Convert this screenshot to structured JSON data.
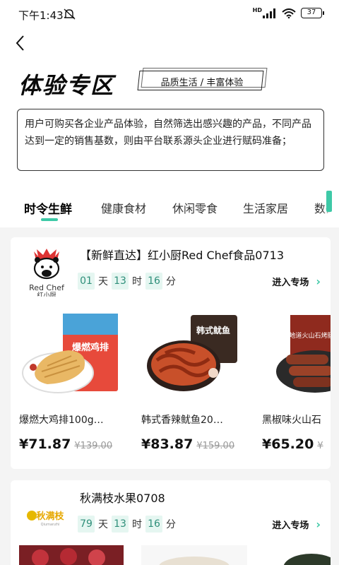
{
  "status_bar": {
    "time": "下午1:43",
    "network": "HD",
    "battery": "37"
  },
  "page": {
    "title": "体验专区",
    "tagline": "品质生活 / 丰富体验",
    "intro": "用户可购买各企业产品体验，自然筛选出感兴趣的产品，不同产品达到一定的销售基数，则由平台联系源头企业进行赋码准备；"
  },
  "tabs": [
    {
      "label": "时令生鲜",
      "active": true
    },
    {
      "label": "健康食材",
      "active": false
    },
    {
      "label": "休闲零食",
      "active": false
    },
    {
      "label": "生活家居",
      "active": false
    },
    {
      "label": "数码",
      "active": false
    }
  ],
  "colors": {
    "accent": "#3ec9a7",
    "countdown_bg": "#e5f6f1",
    "countdown_text": "#2f8f7a"
  },
  "stores": [
    {
      "name": "【新鲜直达】红小厨Red Chef食品0713",
      "logo": {
        "line1": "Red Chef",
        "line2": "红小厨"
      },
      "countdown": {
        "days": "01",
        "hours": "13",
        "minutes": "16",
        "day_unit": "天",
        "hour_unit": "时",
        "minute_unit": "分"
      },
      "enter_label": "进入专场",
      "products": [
        {
          "name": "爆燃大鸡排100g…",
          "price": "¥71.87",
          "original_price": "¥139.00",
          "image_label": "爆燃鸡排"
        },
        {
          "name": "韩式香辣鱿鱼20…",
          "price": "¥83.87",
          "original_price": "¥159.00",
          "image_label": "韩式鱿鱼"
        },
        {
          "name": "黑椒味火山石",
          "price": "¥65.20",
          "original_price": "¥",
          "image_label": "地道火山石烤肠"
        }
      ]
    },
    {
      "name": "秋满枝水果0708",
      "logo": {
        "line1": "秋满枝",
        "line2": "Qiumanzhi"
      },
      "countdown": {
        "days": "79",
        "hours": "13",
        "minutes": "16",
        "day_unit": "天",
        "hour_unit": "时",
        "minute_unit": "分"
      },
      "enter_label": "进入专场"
    }
  ]
}
